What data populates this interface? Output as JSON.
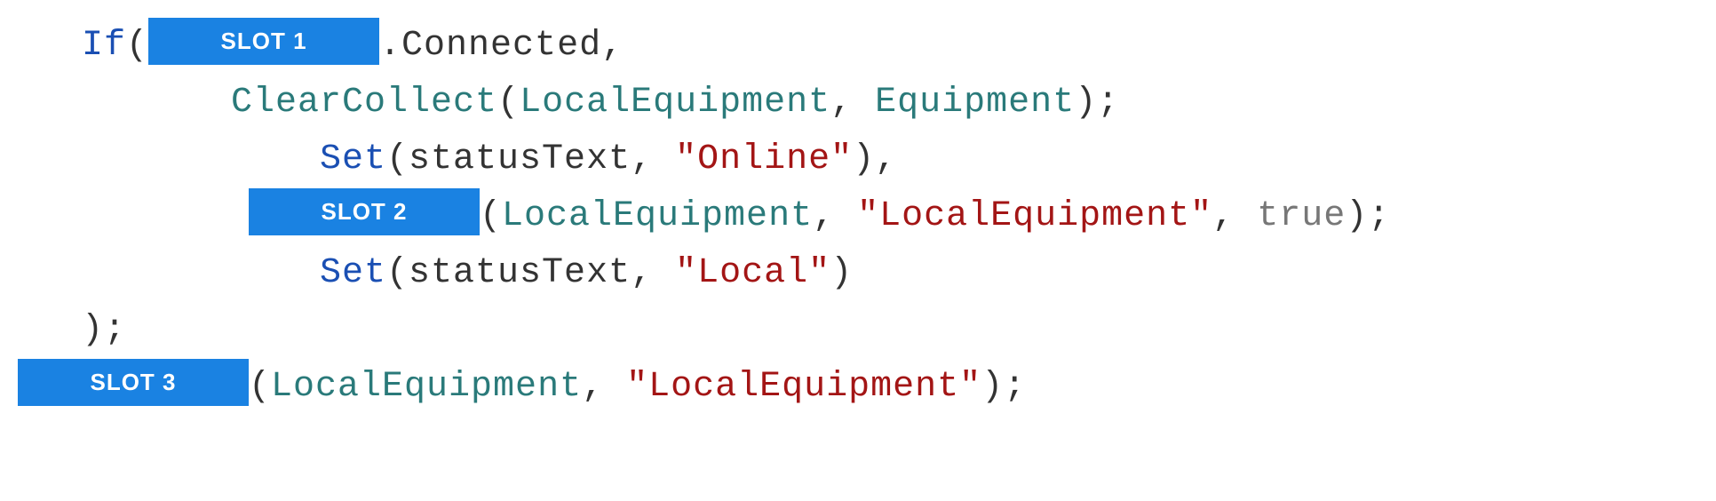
{
  "slots": {
    "slot1": "SLOT 1",
    "slot2": "SLOT 2",
    "slot3": "SLOT 3"
  },
  "code": {
    "if": "If",
    "connected": ".Connected",
    "comma": ",",
    "clearcollect": "ClearCollect",
    "lparen": "(",
    "rparen": ")",
    "localequipment": "LocalEquipment",
    "equipment": "Equipment",
    "semicolon": ";",
    "set": "Set",
    "statustext": "statusText",
    "online": "\"Online\"",
    "localequipment_str": "\"LocalEquipment\"",
    "true": "true",
    "local": "\"Local\"",
    "space": " "
  }
}
